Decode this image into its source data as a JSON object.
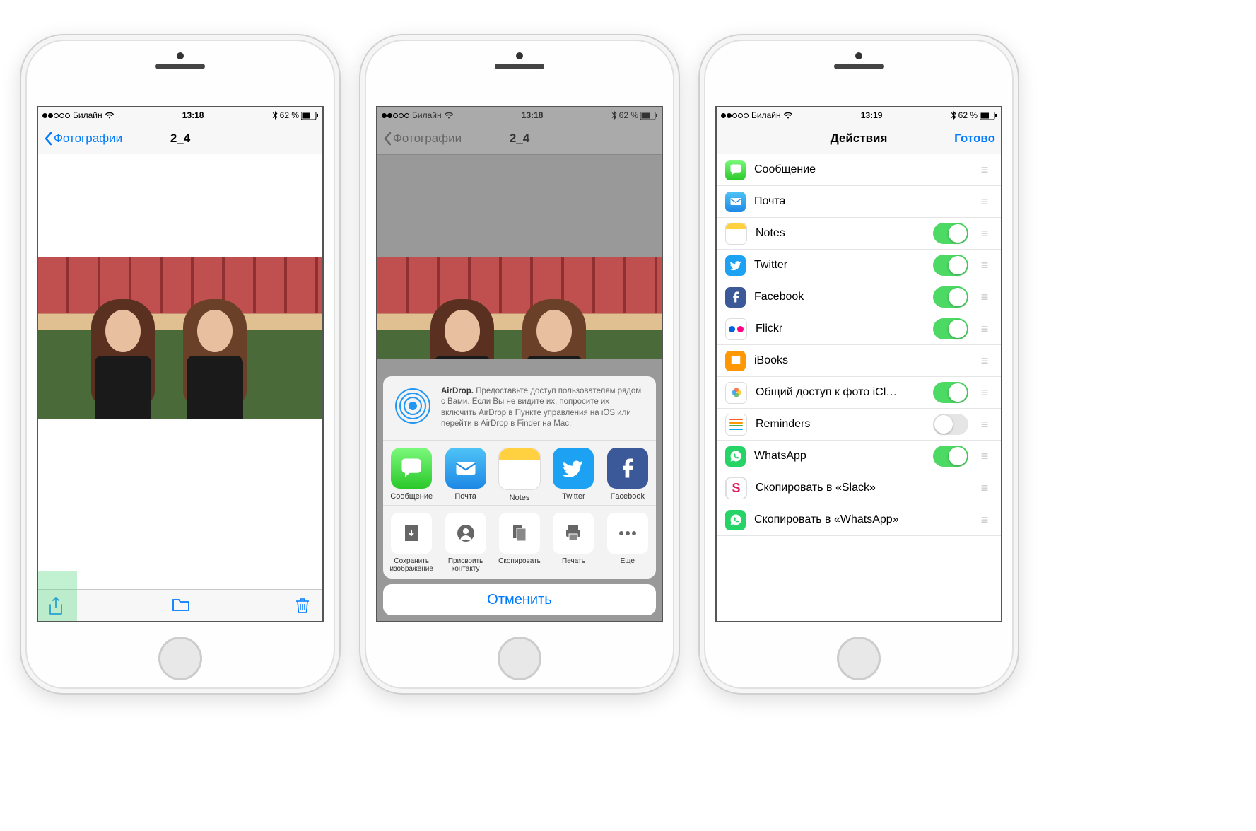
{
  "status": {
    "carrier": "Билайн",
    "battery": "62 %",
    "bt": "⚡"
  },
  "times": {
    "s1": "13:18",
    "s2": "13:18",
    "s3": "13:19"
  },
  "s1": {
    "back": "Фотографии",
    "title": "2_4"
  },
  "s2": {
    "back": "Фотографии",
    "title": "2_4",
    "airdrop_bold": "AirDrop.",
    "airdrop_text": " Предоставьте доступ пользователям рядом с Вами. Если Вы не видите их, попросите их включить AirDrop в Пункте управления на iOS или перейти в AirDrop в Finder на Mac.",
    "apps": [
      {
        "name": "Сообщение",
        "bg": "linear-gradient(#7cf97c,#2ac82a)",
        "glyph": "message"
      },
      {
        "name": "Почта",
        "bg": "linear-gradient(#4fc3f7,#1e88e5)",
        "glyph": "mail"
      },
      {
        "name": "Notes",
        "bg": "#fff",
        "glyph": "notes"
      },
      {
        "name": "Twitter",
        "bg": "#1da1f2",
        "glyph": "twitter"
      },
      {
        "name": "Facebook",
        "bg": "#3b5998",
        "glyph": "facebook"
      }
    ],
    "actions": [
      {
        "name": "Сохранить изображение",
        "glyph": "save"
      },
      {
        "name": "Присвоить контакту",
        "glyph": "contact"
      },
      {
        "name": "Скопировать",
        "glyph": "copy"
      },
      {
        "name": "Печать",
        "glyph": "print"
      },
      {
        "name": "Еще",
        "glyph": "more"
      }
    ],
    "cancel": "Отменить"
  },
  "s3": {
    "title": "Действия",
    "done": "Готово",
    "rows": [
      {
        "label": "Сообщение",
        "icon": "message",
        "bg": "linear-gradient(#7cf97c,#2ac82a)",
        "switch": null
      },
      {
        "label": "Почта",
        "icon": "mail",
        "bg": "linear-gradient(#4fc3f7,#1e88e5)",
        "switch": null
      },
      {
        "label": "Notes",
        "icon": "notes",
        "bg": "#fff",
        "switch": true
      },
      {
        "label": "Twitter",
        "icon": "twitter",
        "bg": "#1da1f2",
        "switch": true
      },
      {
        "label": "Facebook",
        "icon": "facebook",
        "bg": "#3b5998",
        "switch": true
      },
      {
        "label": "Flickr",
        "icon": "flickr",
        "bg": "#fff",
        "switch": true
      },
      {
        "label": "iBooks",
        "icon": "ibooks",
        "bg": "#ff9800",
        "switch": null
      },
      {
        "label": "Общий доступ к фото iCl…",
        "icon": "photos",
        "bg": "#fff",
        "switch": true
      },
      {
        "label": "Reminders",
        "icon": "reminders",
        "bg": "#fff",
        "switch": false
      },
      {
        "label": "WhatsApp",
        "icon": "whatsapp",
        "bg": "#25d366",
        "switch": true
      },
      {
        "label": "Скопировать в «Slack»",
        "icon": "slack",
        "bg": "#fff",
        "switch": null
      },
      {
        "label": "Скопировать в «WhatsApp»",
        "icon": "whatsapp",
        "bg": "#25d366",
        "switch": null
      }
    ]
  }
}
